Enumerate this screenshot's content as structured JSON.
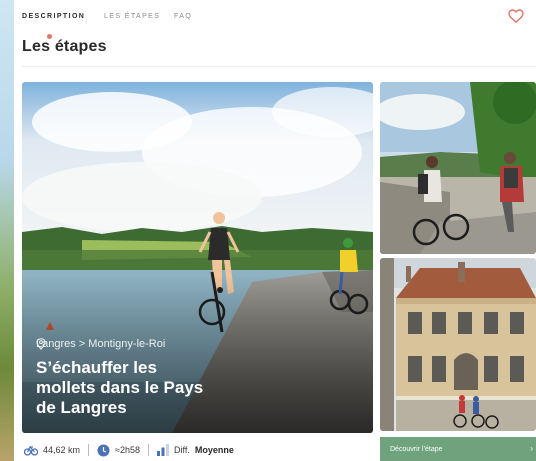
{
  "tabs": [
    {
      "label": "DESCRIPTION",
      "active": true
    },
    {
      "label": "LES ÉTAPES",
      "active": false
    },
    {
      "label": "FAQ",
      "active": false
    }
  ],
  "section_title": "Les étapes",
  "card": {
    "route": "Langres > Montigny-le-Roi",
    "title": "S’échauffer les mollets dans le Pays de Langres"
  },
  "stats": {
    "distance": "44,62 km",
    "duration": "≈2h58",
    "difficulty_label": "Diff.",
    "difficulty_value": "Moyenne"
  },
  "cta_label": "Découvrir l’étape",
  "icons": [
    "heart-icon",
    "pin-icon",
    "bike-icon",
    "clock-icon",
    "difficulty-bars-icon",
    "arrow-right-icon"
  ],
  "colors": {
    "accent": "#e07a63",
    "cta": "#6fa37d",
    "heart": "#e0736b"
  }
}
